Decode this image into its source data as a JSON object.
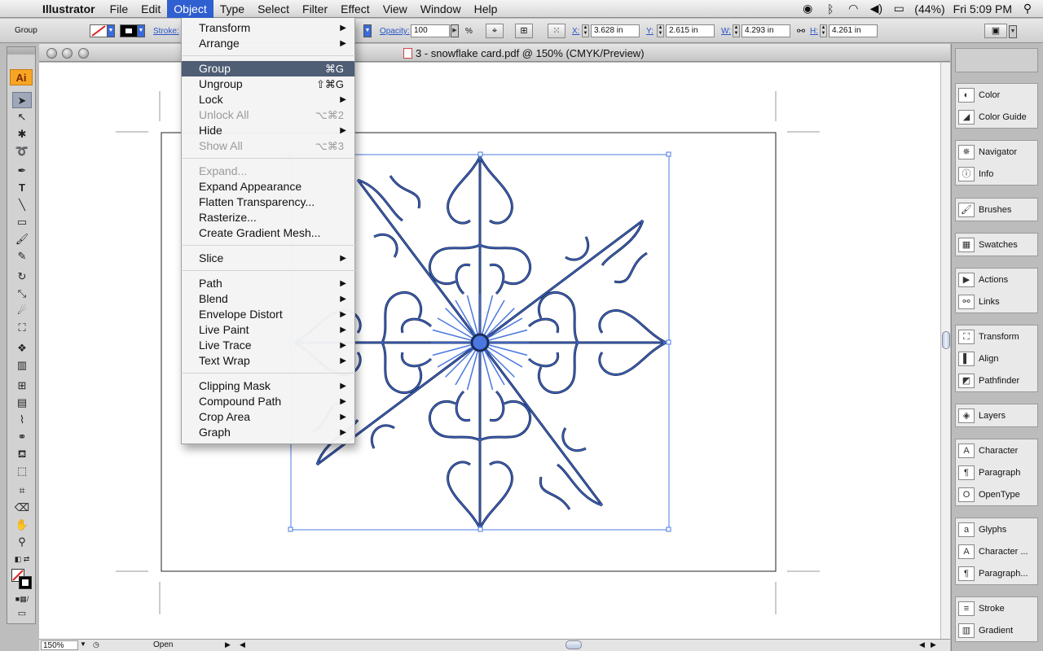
{
  "menubar": {
    "app": "Illustrator",
    "items": [
      "File",
      "Edit",
      "Object",
      "Type",
      "Select",
      "Filter",
      "Effect",
      "View",
      "Window",
      "Help"
    ],
    "battery": "(44%)",
    "clock": "Fri 5:09 PM"
  },
  "controlbar": {
    "selection": "Group",
    "stroke_label": "Stroke:",
    "opacity_label": "Opacity:",
    "opacity_value": "100",
    "opacity_unit": "%",
    "x_label": "X:",
    "x_value": "3.628 in",
    "y_label": "Y:",
    "y_value": "2.615 in",
    "w_label": "W:",
    "w_value": "4.293 in",
    "h_label": "H:",
    "h_value": "4.261 in"
  },
  "document": {
    "title": "3 - snowflake card.pdf @ 150% (CMYK/Preview)",
    "zoom": "150%",
    "status": "Open"
  },
  "tools": {
    "logo": "Ai",
    "items": [
      "selection-tool",
      "direct-selection-tool",
      "magic-wand-tool",
      "lasso-tool",
      "pen-tool",
      "type-tool",
      "line-tool",
      "rectangle-tool",
      "paintbrush-tool",
      "pencil-tool",
      "rotate-tool",
      "scale-tool",
      "warp-tool",
      "free-transform-tool",
      "symbol-sprayer-tool",
      "column-graph-tool",
      "mesh-tool",
      "gradient-tool",
      "eyedropper-tool",
      "blend-tool",
      "live-paint-bucket-tool",
      "live-paint-selection-tool",
      "crop-area-tool",
      "eraser-tool",
      "hand-tool",
      "zoom-tool"
    ]
  },
  "panels": {
    "groups": [
      [
        "Color",
        "Color Guide"
      ],
      [
        "Navigator",
        "Info"
      ],
      [
        "Brushes"
      ],
      [
        "Swatches"
      ],
      [
        "Actions",
        "Links"
      ],
      [
        "Transform",
        "Align",
        "Pathfinder"
      ],
      [
        "Layers"
      ],
      [
        "Character",
        "Paragraph",
        "OpenType"
      ],
      [
        "Glyphs",
        "Character ...",
        "Paragraph..."
      ],
      [
        "Stroke",
        "Gradient"
      ]
    ]
  },
  "object_menu": {
    "items": [
      {
        "label": "Transform",
        "submenu": true
      },
      {
        "label": "Arrange",
        "submenu": true
      },
      {
        "sep": true
      },
      {
        "label": "Group",
        "shortcut": "⌘G",
        "active": true
      },
      {
        "label": "Ungroup",
        "shortcut": "⇧⌘G"
      },
      {
        "label": "Lock",
        "submenu": true
      },
      {
        "label": "Unlock All",
        "shortcut": "⌥⌘2",
        "disabled": true
      },
      {
        "label": "Hide",
        "submenu": true
      },
      {
        "label": "Show All",
        "shortcut": "⌥⌘3",
        "disabled": true
      },
      {
        "sep": true
      },
      {
        "label": "Expand...",
        "disabled": true
      },
      {
        "label": "Expand Appearance"
      },
      {
        "label": "Flatten Transparency..."
      },
      {
        "label": "Rasterize..."
      },
      {
        "label": "Create Gradient Mesh..."
      },
      {
        "sep": true
      },
      {
        "label": "Slice",
        "submenu": true
      },
      {
        "sep": true
      },
      {
        "label": "Path",
        "submenu": true
      },
      {
        "label": "Blend",
        "submenu": true
      },
      {
        "label": "Envelope Distort",
        "submenu": true
      },
      {
        "label": "Live Paint",
        "submenu": true
      },
      {
        "label": "Live Trace",
        "submenu": true
      },
      {
        "label": "Text Wrap",
        "submenu": true
      },
      {
        "sep": true
      },
      {
        "label": "Clipping Mask",
        "submenu": true
      },
      {
        "label": "Compound Path",
        "submenu": true
      },
      {
        "label": "Crop Area",
        "submenu": true
      },
      {
        "label": "Graph",
        "submenu": true
      }
    ]
  },
  "colors": {
    "selection": "#4a78e0",
    "snowflake": "#1a2b5a",
    "menu_highlight": "#4f5d75",
    "menubar_highlight": "#2f5fd0"
  }
}
